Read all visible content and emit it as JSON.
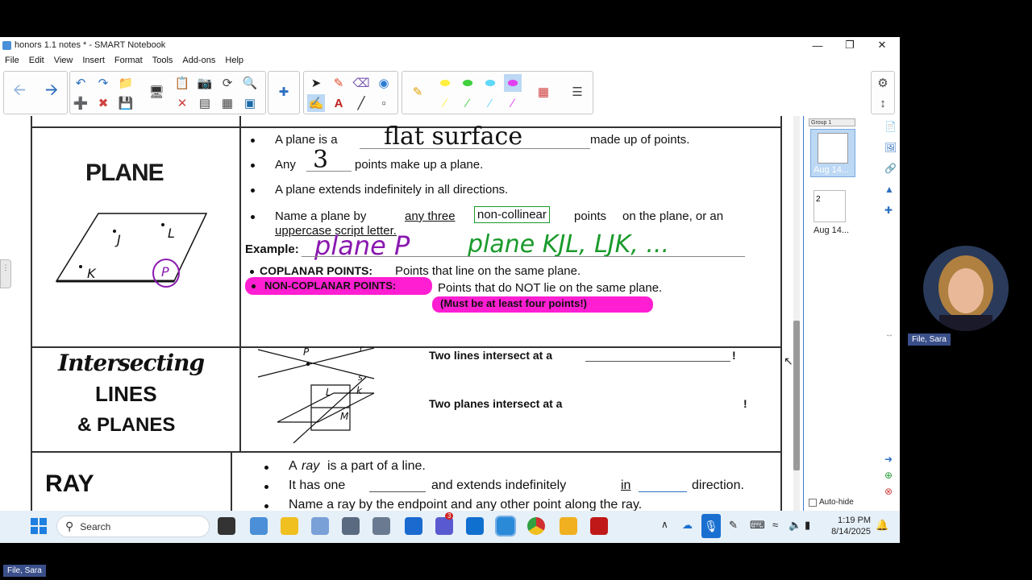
{
  "window": {
    "title": "honors 1.1 notes * - SMART Notebook",
    "menu": [
      "File",
      "Edit",
      "View",
      "Insert",
      "Format",
      "Tools",
      "Add-ons",
      "Help"
    ]
  },
  "lesson": {
    "plane_term": "PLANE",
    "plane_points": [
      "J",
      "L",
      "K",
      "P"
    ],
    "b1_pre": "A plane is a",
    "b1_fill": "flat surface",
    "b1_post": "made up of points.",
    "b2_pre": "Any",
    "b2_fill": "3",
    "b2_post": "points make up a plane.",
    "b3": "A plane extends indefinitely in all directions.",
    "b4_a": "Name a plane by",
    "b4_b": "any three",
    "b4_c": "non-collinear",
    "b4_d": "points",
    "b4_e": "on the plane, or an",
    "b4_line2": "uppercase script letter.",
    "example_label": "Example:",
    "example_hand1": "plane P",
    "example_hand2": "plane KJL, LJK, ...",
    "coplanar_label": "COPLANAR POINTS:",
    "coplanar_def": "Points that line on the same plane.",
    "noncoplanar_label": "NON-COPLANAR POINTS:",
    "noncoplanar_def": "Points that do NOT lie on the same plane.",
    "noncoplanar_note": "(Must be at least four points!)",
    "intersect_word1": "Intersecting",
    "intersect_word2": "LINES",
    "intersect_word3": "& PLANES",
    "diagram_labels": [
      "P",
      "r",
      "s",
      "L",
      "k",
      "M"
    ],
    "lines_q": "Two lines intersect at a",
    "planes_q": "Two planes intersect at a",
    "exclaim": "!",
    "ray_term": "RAY",
    "ray_b1_a": "A",
    "ray_b1_b": "ray",
    "ray_b1_c": "is a part of a line.",
    "ray_b2_a": "It has one",
    "ray_b2_b": "and extends indefinitely",
    "ray_b2_c": "in",
    "ray_b2_d": "direction.",
    "ray_b3": "Name a ray by the endpoint and any other point along the ray."
  },
  "sidebar": {
    "group_label": "Group 1",
    "pages": [
      {
        "num": "1",
        "label": "Aug 14..."
      },
      {
        "num": "2",
        "label": "Aug 14..."
      }
    ],
    "autohide_label": "Auto-hide"
  },
  "taskbar": {
    "search_placeholder": "Search",
    "time": "1:19 PM",
    "date": "8/14/2025",
    "teams_badge": "3"
  },
  "participant": {
    "name": "File, Sara"
  },
  "colors": {
    "highlight_magenta": "#ff1ed2",
    "ink_green": "#1a9a2c",
    "ink_purple": "#8a18b0",
    "accent": "#2d6fbf"
  }
}
